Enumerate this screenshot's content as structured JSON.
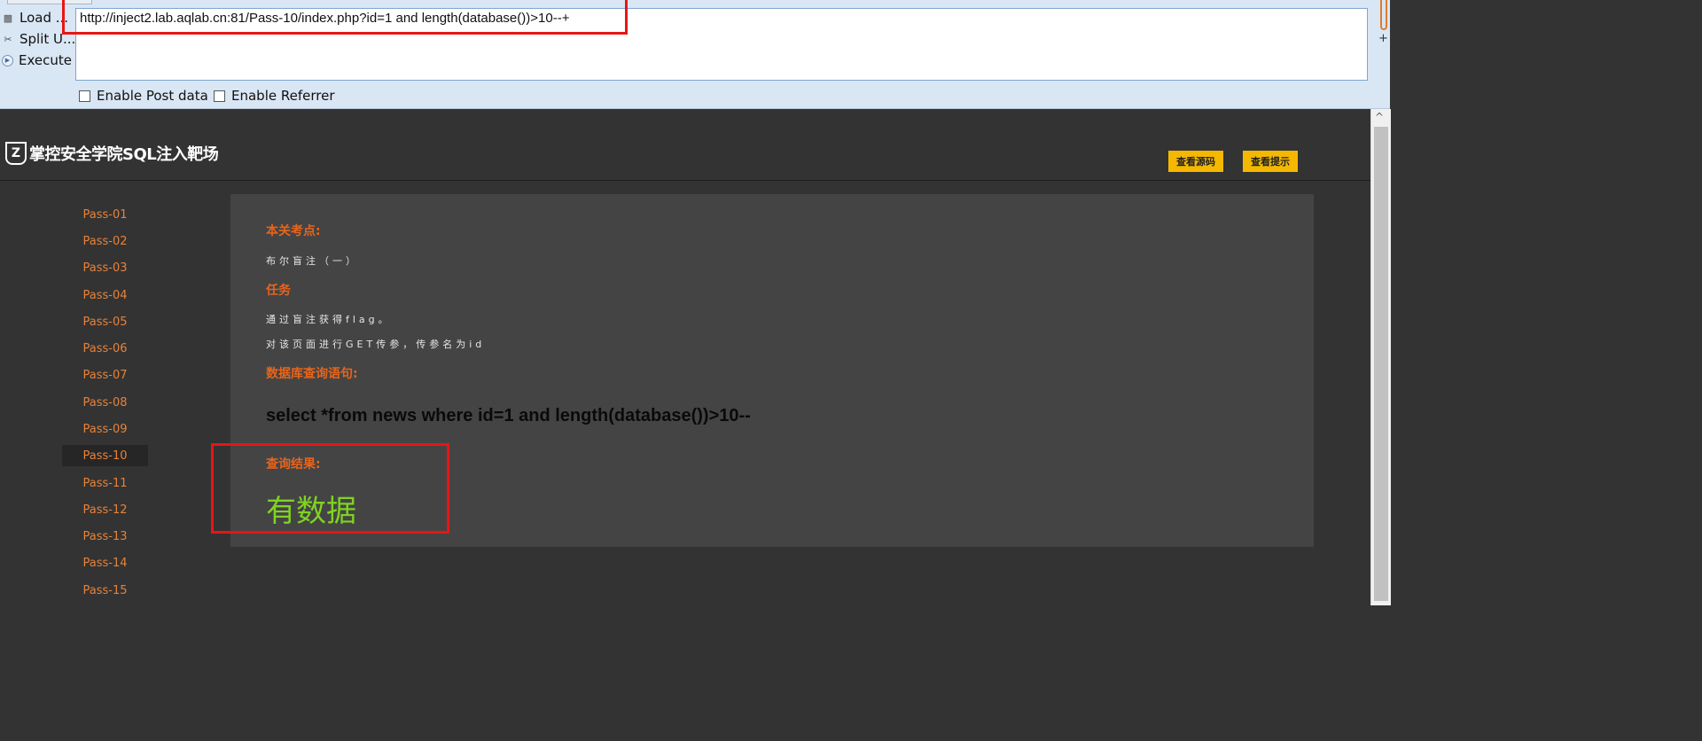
{
  "hackbar": {
    "actions": [
      {
        "label": "Load ...",
        "icon": "load-url-icon"
      },
      {
        "label": "Split U...",
        "icon": "scissors-icon"
      },
      {
        "label": "Execute",
        "icon": "execute-arrow-icon"
      }
    ],
    "url_value": "http://inject2.lab.aqlab.cn:81/Pass-10/index.php?id=1 and length(database())>10--+",
    "options": [
      {
        "label": "Enable Post data",
        "checked": false
      },
      {
        "label": "Enable Referrer",
        "checked": false
      }
    ]
  },
  "header": {
    "logo_text": "掌控安全学院SQL注入靶场",
    "buttons": [
      "查看源码",
      "查看提示"
    ]
  },
  "sidebar": {
    "items": [
      "Pass-01",
      "Pass-02",
      "Pass-03",
      "Pass-04",
      "Pass-05",
      "Pass-06",
      "Pass-07",
      "Pass-08",
      "Pass-09",
      "Pass-10",
      "Pass-11",
      "Pass-12",
      "Pass-13",
      "Pass-14",
      "Pass-15"
    ],
    "active": "Pass-10"
  },
  "main": {
    "topic_heading": "本关考点:",
    "topic_text": "布尔盲注（一）",
    "task_heading": "任务",
    "task_line1": "通过盲注获得flag。",
    "task_line2": "对该页面进行GET传参，传参名为id",
    "query_heading": "数据库查询语句:",
    "query_sql": "select *from news where id=1 and length(database())>10--",
    "result_heading": "查询结果:",
    "result_value": "有数据"
  },
  "colors": {
    "accent_orange": "#e8641b",
    "sidebar_link": "#e7823a",
    "result_green": "#7fd321",
    "button_yellow": "#f5b800",
    "annotation_red": "#e81515"
  }
}
